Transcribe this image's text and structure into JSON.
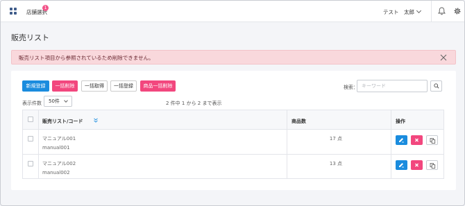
{
  "header": {
    "store_select_label": "店舗選択",
    "store_badge_count": "1",
    "user_name": "テスト　太郎"
  },
  "page": {
    "title": "販売リスト"
  },
  "alert": {
    "message": "販売リスト項目から参照されているため削除できません。"
  },
  "toolbar": {
    "new_label": "新規登録",
    "bulk_delete_label": "一括削除",
    "bulk_fetch_label": "一括取得",
    "bulk_register_label": "一括登録",
    "product_bulk_delete_label": "商品一括削除"
  },
  "search": {
    "label": "検索：",
    "placeholder": "キーワード"
  },
  "pagination": {
    "count_label": "表示件数",
    "count_value": "50件",
    "info": "2 件中 1 から 2 まで表示"
  },
  "table": {
    "columns": {
      "name": "販売リスト/コード",
      "count": "商品数",
      "actions": "操作"
    },
    "rows": [
      {
        "name": "マニュアル001",
        "code": "manual001",
        "count": "17 点"
      },
      {
        "name": "マニュアル002",
        "code": "manual002",
        "count": "13 点"
      }
    ]
  },
  "colors": {
    "primary": "#1a8cde",
    "danger": "#f2477e",
    "alert_bg": "#f9d8dc"
  },
  "icons": {
    "apps": "grid-icon",
    "notifications": "bell-icon",
    "settings": "gear-icon",
    "close": "close-icon",
    "search": "search-icon",
    "edit": "edit-icon",
    "delete": "delete-icon",
    "copy": "copy-icon",
    "sort": "sort-icon"
  }
}
